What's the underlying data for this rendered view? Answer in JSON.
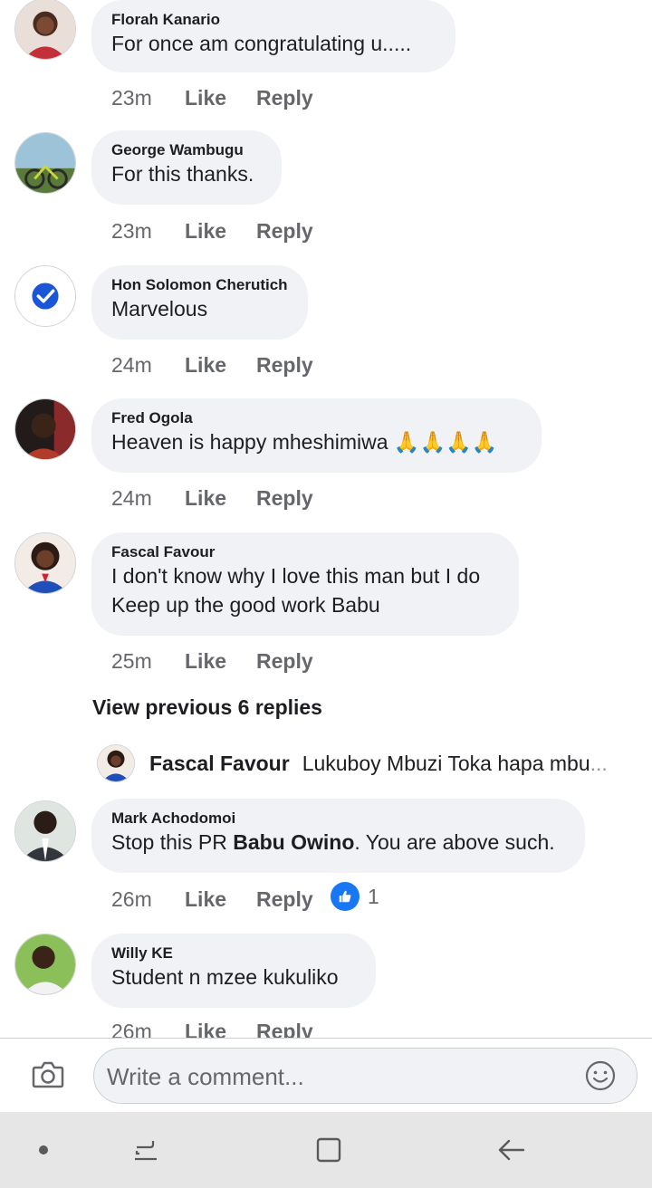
{
  "comments": [
    {
      "author": "Florah Kanario",
      "text": "For once am congratulating  u.....",
      "time": "23m",
      "like": "Like",
      "reply": "Reply"
    },
    {
      "author": "George Wambugu",
      "text": "For this thanks.",
      "time": "23m",
      "like": "Like",
      "reply": "Reply"
    },
    {
      "author": "Hon Solomon Cherutich",
      "text": "Marvelous",
      "time": "24m",
      "like": "Like",
      "reply": "Reply"
    },
    {
      "author": "Fred Ogola",
      "text": "Heaven is happy mheshimiwa 🙏🙏🙏🙏",
      "time": "24m",
      "like": "Like",
      "reply": "Reply"
    },
    {
      "author": "Fascal Favour",
      "text_line1": "I don't know why I love this man but I do",
      "text_line2": "Keep up the good work Babu",
      "time": "25m",
      "like": "Like",
      "reply": "Reply"
    },
    {
      "author": "Mark Achodomoi",
      "text_before": "Stop this PR ",
      "text_tag": "Babu Owino",
      "text_after": ". You are above such.",
      "time": "26m",
      "like": "Like",
      "reply": "Reply",
      "reaction_count": "1"
    },
    {
      "author": "Willy KE",
      "text": "Student n mzee kukuliko",
      "time": "26m",
      "like": "Like",
      "reply": "Reply"
    }
  ],
  "replies_section": {
    "view_previous": "View previous 6 replies",
    "preview_author": "Fascal Favour",
    "preview_text": "Lukuboy Mbuzi Toka hapa mbu",
    "preview_ellipsis": "..."
  },
  "composer": {
    "placeholder": "Write a comment..."
  },
  "icons": {
    "camera": "camera-icon",
    "emoji": "smiley-icon",
    "verified": "verified-check-icon",
    "like_reaction": "thumbs-up-icon"
  },
  "colors": {
    "brand_blue": "#1877f2",
    "bubble_bg": "#f0f2f5",
    "meta_text": "#65676b",
    "navbar_bg": "#e6e6e6"
  }
}
